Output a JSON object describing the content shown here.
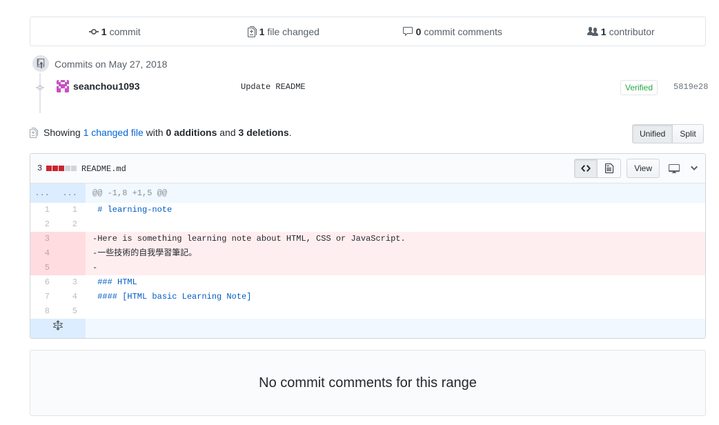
{
  "summary": {
    "commits": "1",
    "commits_label": "commit",
    "files": "1",
    "files_label": "file changed",
    "comments": "0",
    "comments_label": "commit comments",
    "contributors": "1",
    "contributors_label": "contributor"
  },
  "commit_group": {
    "date_label": "Commits on May 27, 2018",
    "author": "seanchou1093",
    "message": "Update README",
    "verified_label": "Verified",
    "sha": "5819e28"
  },
  "stats": {
    "showing": "Showing",
    "changed_files_link": "1 changed file",
    "with": "with",
    "additions": "0 additions",
    "and": "and",
    "deletions": "3 deletions",
    "period": "."
  },
  "view_toggle": {
    "unified": "Unified",
    "split": "Split",
    "selected": "Unified"
  },
  "file": {
    "changes_count": "3",
    "filename": "README.md",
    "view_button": "View",
    "diffstat_colors": [
      "#cb2431",
      "#cb2431",
      "#cb2431",
      "#d1d5da",
      "#d1d5da"
    ]
  },
  "diff": {
    "hunk_header": "@@ -1,8 +1,5 @@",
    "hunk_left": "...",
    "hunk_right": "...",
    "lines": [
      {
        "type": "ctx",
        "old": "1",
        "new": "1",
        "text": " # learning-note"
      },
      {
        "type": "ctx",
        "old": "2",
        "new": "2",
        "text": ""
      },
      {
        "type": "del",
        "old": "3",
        "new": "",
        "text": "-Here is something learning note about HTML, CSS or JavaScript."
      },
      {
        "type": "del",
        "old": "4",
        "new": "",
        "text": "-一些技術的自我學習筆記。"
      },
      {
        "type": "del",
        "old": "5",
        "new": "",
        "text": "-"
      },
      {
        "type": "ctx",
        "old": "6",
        "new": "3",
        "text": " ### HTML"
      },
      {
        "type": "ctx",
        "old": "7",
        "new": "4",
        "text": " #### [HTML basic Learning Note]"
      },
      {
        "type": "ctx",
        "old": "8",
        "new": "5",
        "text": ""
      }
    ]
  },
  "no_comments": {
    "title": "No commit comments for this range"
  },
  "icons": {
    "commit": "git-commit-icon",
    "file_diff": "file-diff-icon",
    "comment": "comment-icon",
    "people": "people-icon",
    "code": "code-icon",
    "file": "file-icon",
    "desktop": "device-desktop-icon",
    "chevron": "chevron-down-icon",
    "unfold": "unfold-icon"
  }
}
